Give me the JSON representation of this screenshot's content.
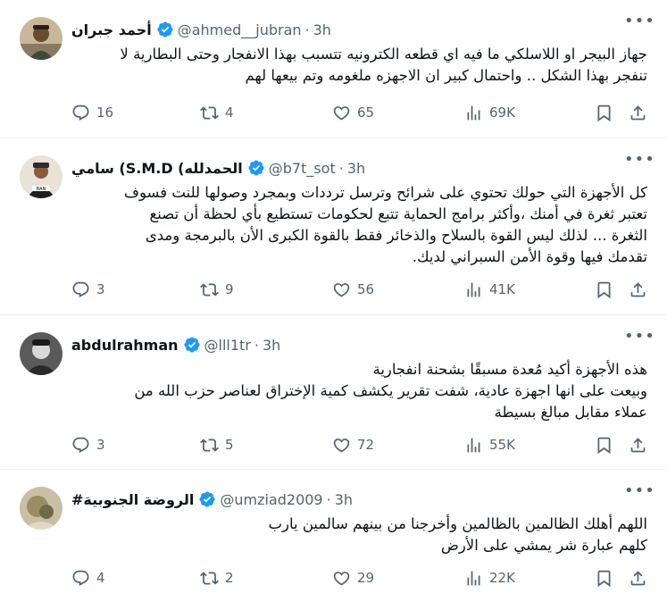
{
  "tweets": [
    {
      "name": "أحمد جبران",
      "handle": "@ahmed__jubran",
      "time": "3h",
      "lines": [
        "جهاز البيجر او اللاسلكي ما فيه اي قطعه الكترونيه تتسبب بهذا الانفجار وحتى البطارية لا",
        "تنفجر بهذا الشكل .. واحتمال كبير ان الاجهزه ملغومه وتم بيعها لهم"
      ],
      "replies": "16",
      "reposts": "4",
      "likes": "65",
      "views": "69K"
    },
    {
      "name": "الحمدلله) S.M.D) سامي",
      "handle": "@b7t_sot",
      "time": "3h",
      "lines": [
        "كل الأجهزة التي حولك تحتوي على شرائح وترسل ترددات وبمجرد وصولها للنت فسوف",
        "تعتبر ثغرة في أمنك ،وأكثر برامج الحماية تتبع لحكومات تستطيع بأي لحظة أن تصنع",
        "الثغرة ... لذلك ليس القوة بالسلاح والذخائر فقط بالقوة الكبرى الأن بالبرمجة ومدى",
        "تقدمك فيها وقوة الأمن السبراني لديك."
      ],
      "replies": "3",
      "reposts": "9",
      "likes": "56",
      "views": "41K"
    },
    {
      "name": "abdulrahman",
      "handle": "@lll1tr",
      "time": "3h",
      "lines": [
        "هذه الأجهزة أكيد مُعدة مسبقًا بشحنة انفجارية",
        "وبيعت على انها اجهزة عادية، شفت تقرير يكشف كمية الإختراق لعناصر حزب الله من",
        "عملاء مقابل مبالغ بسيطة"
      ],
      "replies": "3",
      "reposts": "5",
      "likes": "72",
      "views": "55K"
    },
    {
      "name": "الروضة الجنوبية#",
      "handle": "@umziad2009",
      "time": "3h",
      "lines": [
        "اللهم أهلك الظالمين بالظالمين وأخرجنا من بينهم سالمين يارب",
        "كلهم عبارة شر يمشي على الأرض"
      ],
      "replies": "4",
      "reposts": "2",
      "likes": "29",
      "views": "22K"
    }
  ],
  "colors": {
    "text": "#0f1419",
    "secondary": "#536471",
    "verified": "#1d9bf0",
    "divider": "#eff3f4"
  },
  "icons": [
    "reply-icon",
    "repost-icon",
    "like-icon",
    "views-icon",
    "bookmark-icon",
    "share-icon",
    "verified-badge-icon",
    "more-icon"
  ]
}
